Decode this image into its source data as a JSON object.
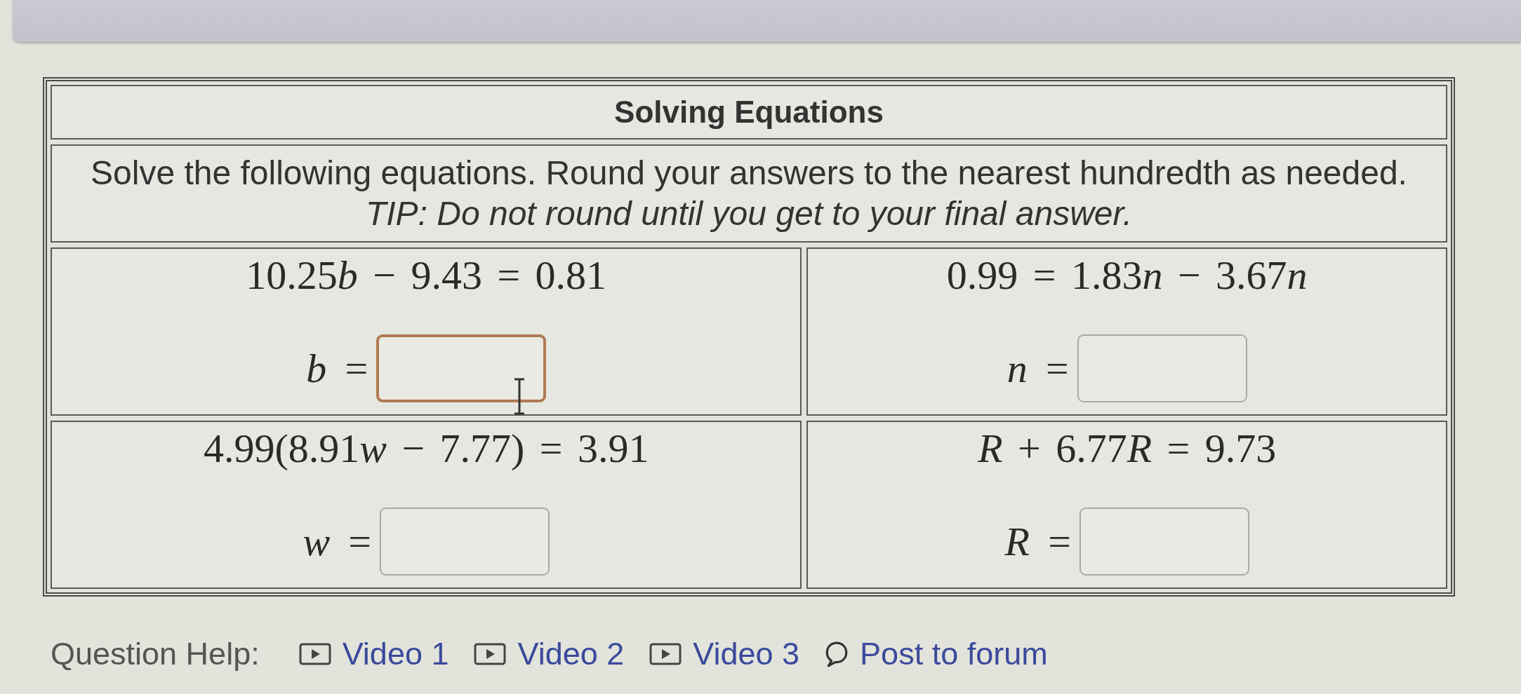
{
  "problem": {
    "title": "Solving Equations",
    "instructions": "Solve the following equations. Round your answers to the nearest hundredth as needed.",
    "tip": "TIP: Do not round until you get to your final answer."
  },
  "equations": [
    {
      "equation": [
        "10.25",
        "*b*",
        " − 9.43 = 0.81"
      ],
      "label": "*b* =",
      "focused": true,
      "hovered": true
    },
    {
      "equation": [
        "0.99 = 1.83",
        "*n*",
        " − 3.67",
        "*n*"
      ],
      "label": "*n* =",
      "focused": false,
      "hovered": false
    },
    {
      "equation": [
        "4.99(8.91",
        "*w*",
        " − 7.77) = 3.91"
      ],
      "label": "*w* =",
      "focused": false,
      "hovered": false
    },
    {
      "equation": [
        "*R*",
        " + 6.77",
        "*R*",
        " = 9.73"
      ],
      "label": "*R* =",
      "focused": false,
      "hovered": false
    }
  ],
  "question_help": {
    "label": "Question Help:",
    "links": [
      {
        "kind": "video",
        "label": "Video 1"
      },
      {
        "kind": "video",
        "label": "Video 2"
      },
      {
        "kind": "video",
        "label": "Video 3"
      },
      {
        "kind": "forum",
        "label": "Post to forum"
      }
    ]
  }
}
